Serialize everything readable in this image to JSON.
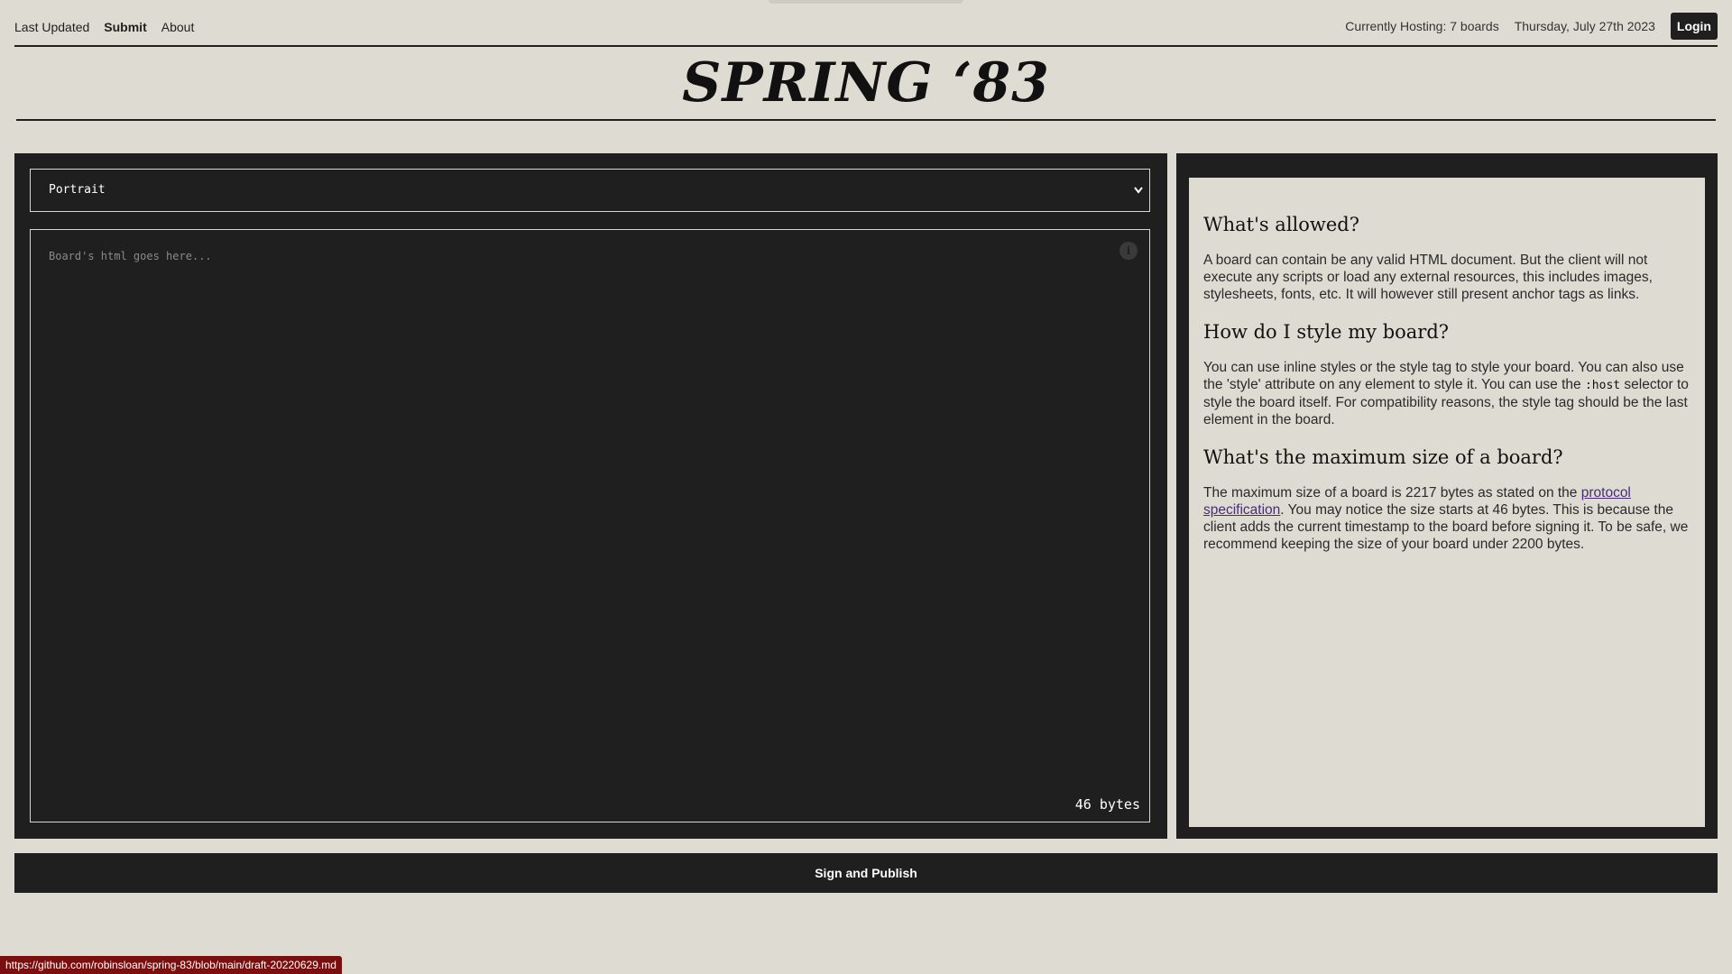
{
  "nav": {
    "left_items": [
      {
        "label": "Last Updated"
      },
      {
        "label": "Submit"
      },
      {
        "label": "About"
      }
    ],
    "hosting": "Currently Hosting: 7 boards",
    "date": "Thursday, July 27th 2023",
    "login_label": "Login"
  },
  "title": "SPRING ‘83",
  "editor": {
    "orientation_value": "Portrait",
    "orientation_chevron": "chevron-down-icon",
    "placeholder": "Board's html goes here...",
    "info_icon": "info-icon",
    "byte_count": "46 bytes"
  },
  "help": {
    "q1": "What's allowed?",
    "a1": "A board can contain be any valid HTML document. But the client will not execute any scripts or load any external resources, this includes images, stylesheets, fonts, etc. It will however still present anchor tags as links.",
    "q2": "How do I style my board?",
    "a2_part1": "You can use inline styles or the style tag to style your board. You can also use the 'style' attribute on any element to style it. You can use the",
    "a2_code": ":host",
    "a2_part2": "selector to style the board itself. For compatibility reasons, the style tag should be the last element in the board.",
    "q3": "What's the maximum size of a board?",
    "a3_part1": "The maximum size of a board is 2217 bytes as stated on the",
    "a3_link": "protocol specification",
    "a3_part2": ". You may notice the size starts at 46 bytes. This is because the client adds the current timestamp to the board before signing it. To be safe, we recommend keeping the size of your board under 2200 bytes."
  },
  "publish_label": "Sign and Publish",
  "status_url": "https://github.com/robinsloan/spring-83/blob/main/draft-20220629.md",
  "colors": {
    "background": "#dedbd3",
    "panel": "#1f1f1f",
    "link": "#4a2c7a",
    "status_bar": "#7a0f0f"
  }
}
